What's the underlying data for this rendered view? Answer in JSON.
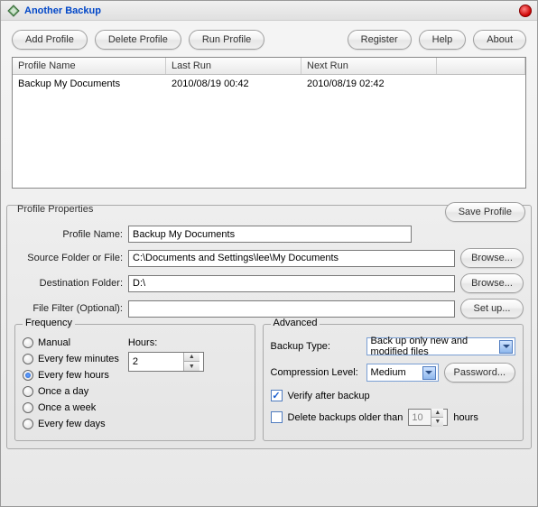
{
  "titlebar": {
    "title": "Another Backup"
  },
  "toolbar": {
    "add_profile": "Add Profile",
    "delete_profile": "Delete Profile",
    "run_profile": "Run Profile",
    "register": "Register",
    "help": "Help",
    "about": "About"
  },
  "table": {
    "headers": {
      "profile_name": "Profile Name",
      "last_run": "Last Run",
      "next_run": "Next Run"
    },
    "rows": [
      {
        "profile_name": "Backup My Documents",
        "last_run": "2010/08/19 00:42",
        "next_run": "2010/08/19 02:42"
      }
    ]
  },
  "props": {
    "legend": "Profile Properties",
    "save_profile": "Save Profile",
    "labels": {
      "profile_name": "Profile Name:",
      "source": "Source Folder or File:",
      "destination": "Destination Folder:",
      "filter": "File Filter (Optional):"
    },
    "values": {
      "profile_name": "Backup My Documents",
      "source": "C:\\Documents and Settings\\lee\\My Documents",
      "destination": "D:\\",
      "filter": ""
    },
    "browse": "Browse...",
    "setup": "Set up..."
  },
  "frequency": {
    "legend": "Frequency",
    "options": {
      "manual": "Manual",
      "every_few_minutes": "Every few minutes",
      "every_few_hours": "Every few hours",
      "once_a_day": "Once a day",
      "once_a_week": "Once a week",
      "every_few_days": "Every few days"
    },
    "selected": "every_few_hours",
    "hours_label": "Hours:",
    "hours_value": "2"
  },
  "advanced": {
    "legend": "Advanced",
    "backup_type_label": "Backup Type:",
    "backup_type_value": "Back up only new and modified files",
    "compression_label": "Compression Level:",
    "compression_value": "Medium",
    "password": "Password...",
    "verify_label": "Verify after backup",
    "verify_checked": true,
    "delete_label": "Delete backups older than",
    "delete_checked": false,
    "delete_value": "10",
    "delete_unit": "hours"
  }
}
